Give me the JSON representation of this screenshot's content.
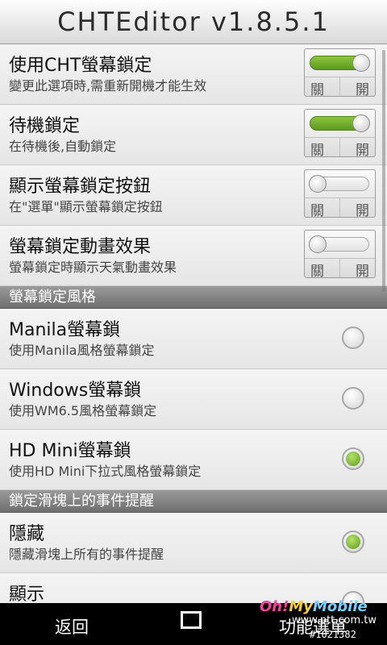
{
  "title": "CHTEditor v1.8.5.1",
  "toggle_labels": {
    "off": "關",
    "on": "開"
  },
  "lock_settings": [
    {
      "title": "使用CHT螢幕鎖定",
      "subtitle": "變更此選項時,需重新開機才能生效",
      "enabled": true
    },
    {
      "title": "待機鎖定",
      "subtitle": "在待機後,自動鎖定",
      "enabled": true
    },
    {
      "title": "顯示螢幕鎖定按鈕",
      "subtitle": "在\"選單\"顯示螢幕鎖定按鈕",
      "enabled": false
    },
    {
      "title": "螢幕鎖定動畫效果",
      "subtitle": "螢幕鎖定時顯示天氣動畫效果",
      "enabled": false
    }
  ],
  "style_section": {
    "header": "螢幕鎖定風格",
    "options": [
      {
        "title": "Manila螢幕鎖",
        "subtitle": "使用Manila風格螢幕鎖定",
        "selected": false
      },
      {
        "title": "Windows螢幕鎖",
        "subtitle": "使用WM6.5風格螢幕鎖定",
        "selected": false
      },
      {
        "title": "HD Mini螢幕鎖",
        "subtitle": "使用HD Mini下拉式風格螢幕鎖定",
        "selected": true
      }
    ]
  },
  "event_section": {
    "header": "鎖定滑塊上的事件提醒",
    "options": [
      {
        "title": "隱藏",
        "subtitle": "隱藏滑塊上所有的事件提醒",
        "selected": true
      },
      {
        "title": "顯示",
        "subtitle": "",
        "selected": false
      }
    ]
  },
  "bottom_bar": {
    "back_label": "返回",
    "menu_label": "功能選單",
    "home_icon": "square-icon"
  },
  "watermark": {
    "logo": "Oh!MyMobile",
    "site": "www.ptt.com.tw",
    "id": "#1021382"
  },
  "colors": {
    "toggle_on": "#7ab536",
    "radio_selected": "#7ab536",
    "section_bg": "#808080",
    "bottom_bar": "#000000"
  }
}
